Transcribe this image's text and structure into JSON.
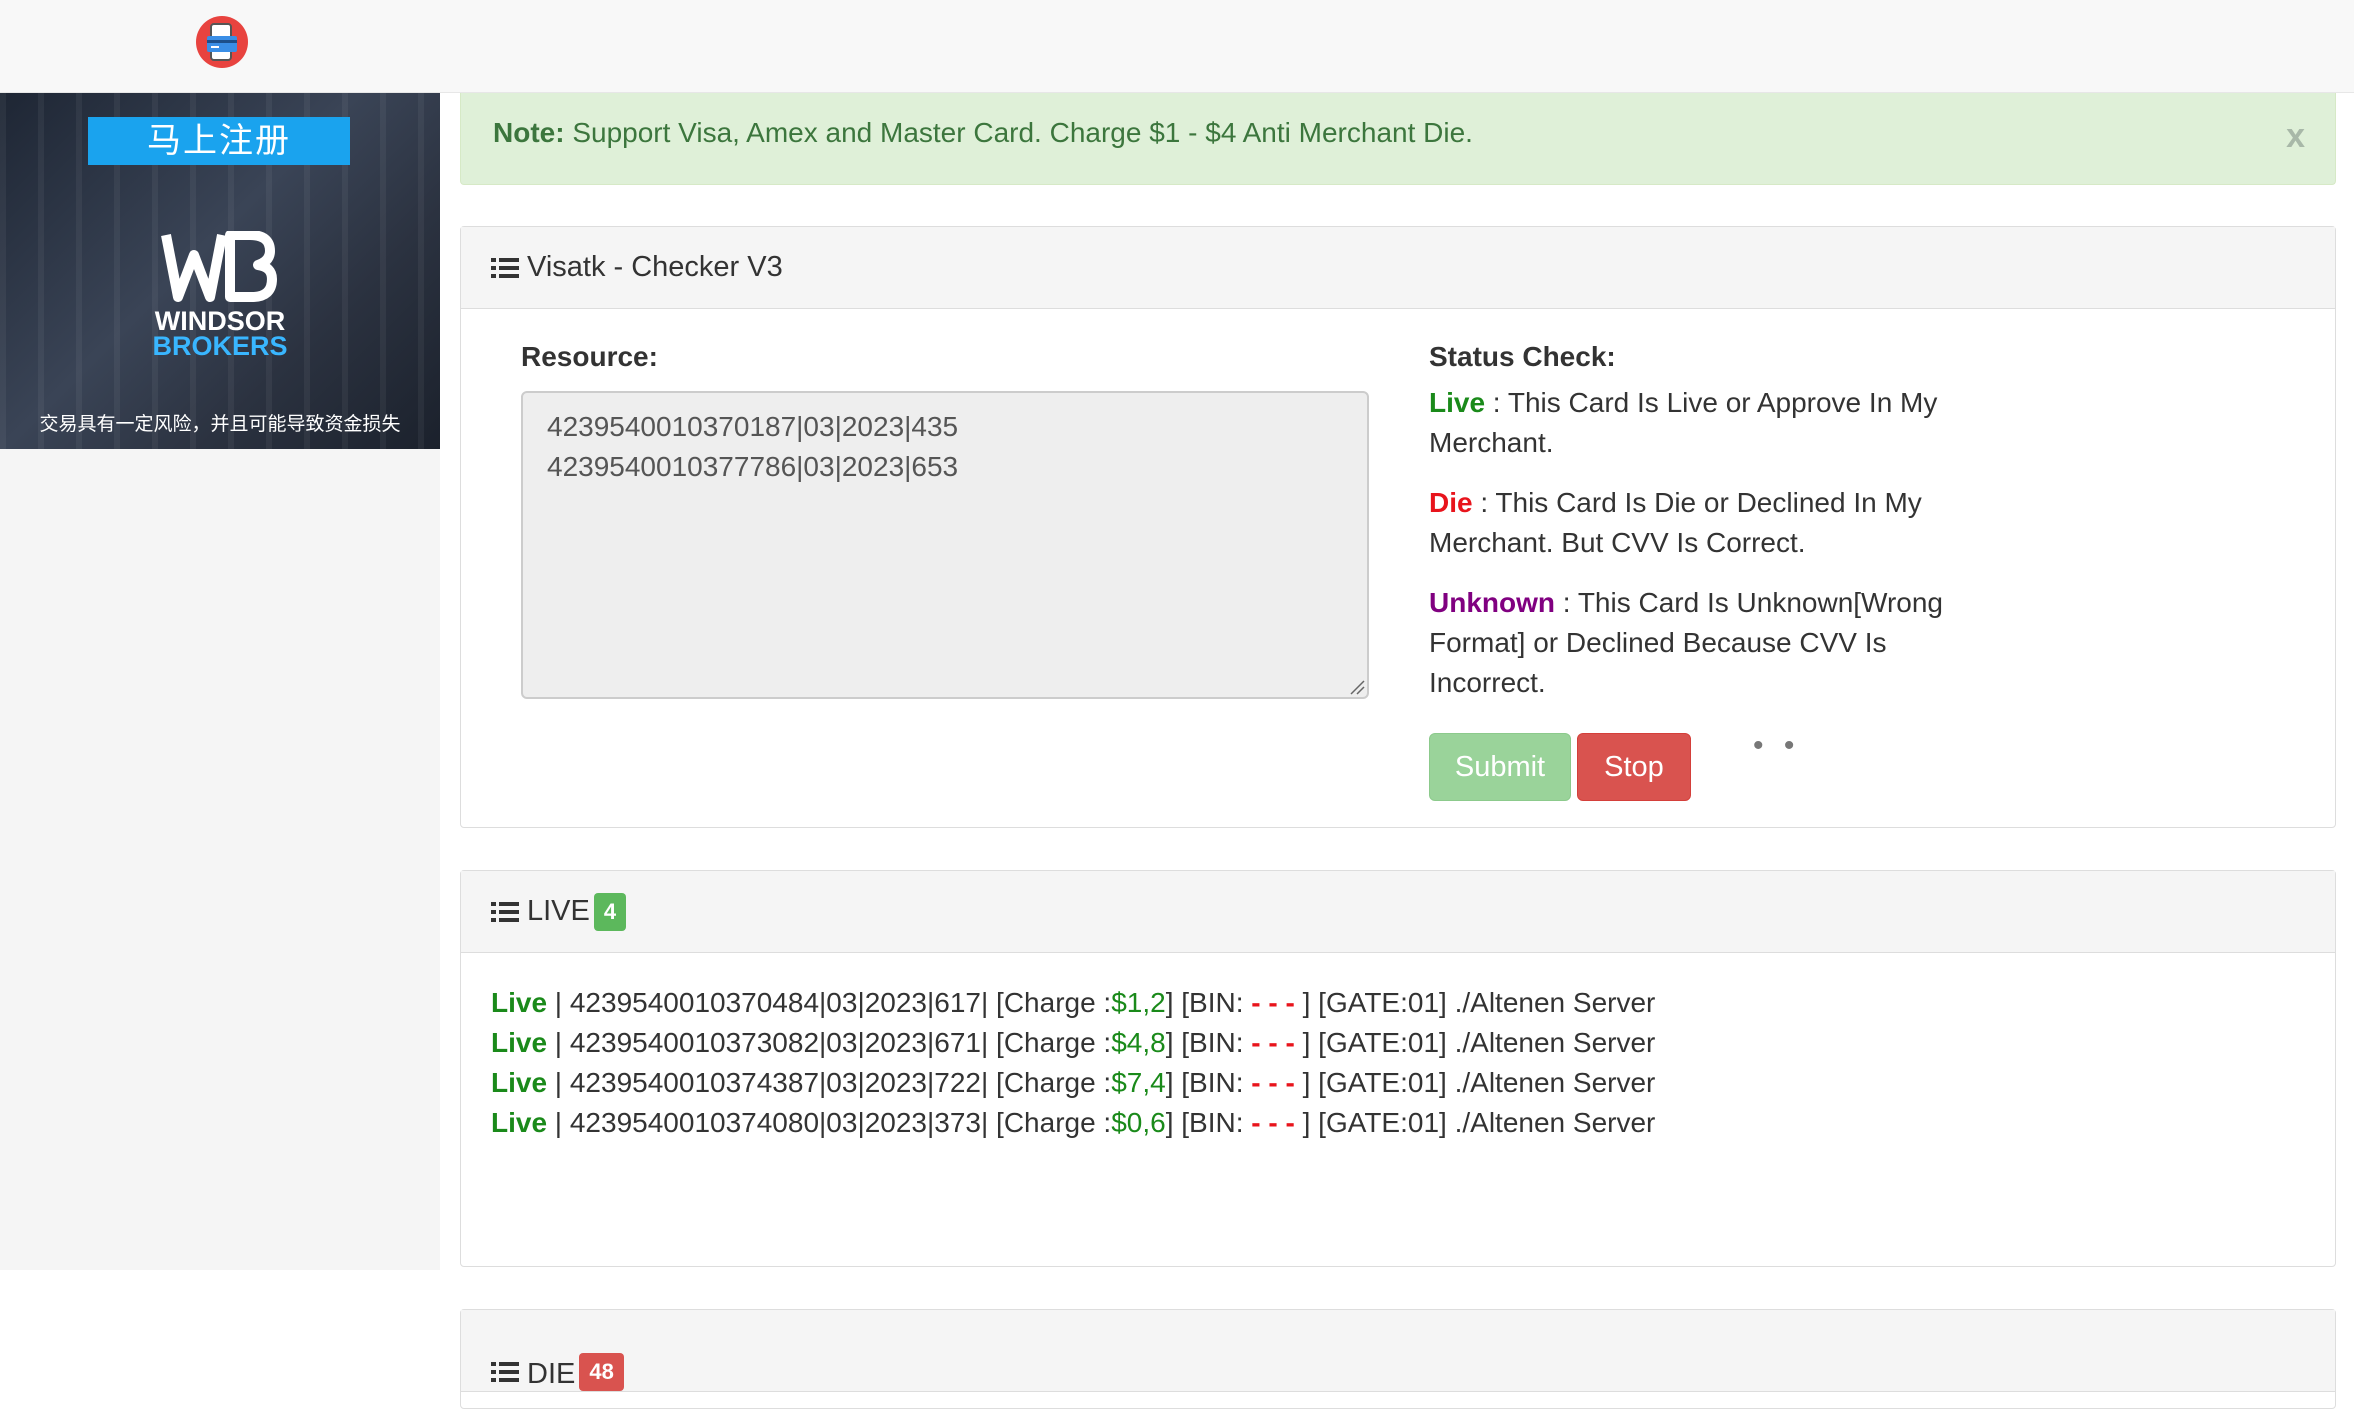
{
  "ad": {
    "register_label": "马上注册",
    "brand_line1": "WINDSOR",
    "brand_line2": "BROKERS",
    "disclaimer": "交易具有一定风险，并且可能导致资金损失"
  },
  "alert": {
    "label": "Note:",
    "message": "Support Visa, Amex and Master Card. Charge $1 - $4 Anti Merchant Die.",
    "close": "x"
  },
  "checker": {
    "title": "Visatk - Checker V3",
    "resource_label": "Resource:",
    "resource_value": "4239540010370187|03|2023|435\n4239540010377786|03|2023|653",
    "status_label": "Status Check:",
    "live_word": "Live",
    "live_desc": " : This Card Is Live or Approve In My Merchant.",
    "die_word": "Die",
    "die_desc": " : This Card Is Die or Declined In My Merchant. But CVV Is Correct.",
    "unknown_word": "Unknown",
    "unknown_desc": " : This Card Is Unknown[Wrong Format] or Declined Because CVV Is Incorrect.",
    "submit_label": "Submit",
    "stop_label": "Stop",
    "loading_dots": "• •"
  },
  "live_panel": {
    "title": "LIVE",
    "count": "4",
    "rows": [
      {
        "status": "Live",
        "card": " | 4239540010370484|03|2023|617| [Charge :",
        "charge": "$1,2",
        "bin_prefix": "] [BIN: ",
        "bin": "- - -",
        "suffix": " ] [GATE:01] ./Altenen Server"
      },
      {
        "status": "Live",
        "card": " | 4239540010373082|03|2023|671| [Charge :",
        "charge": "$4,8",
        "bin_prefix": "] [BIN: ",
        "bin": "- - -",
        "suffix": " ] [GATE:01] ./Altenen Server"
      },
      {
        "status": "Live",
        "card": " | 4239540010374387|03|2023|722| [Charge :",
        "charge": "$7,4",
        "bin_prefix": "] [BIN: ",
        "bin": "- - -",
        "suffix": " ] [GATE:01] ./Altenen Server"
      },
      {
        "status": "Live",
        "card": " | 4239540010374080|03|2023|373| [Charge :",
        "charge": "$0,6",
        "bin_prefix": "] [BIN: ",
        "bin": "- - -",
        "suffix": " ] [GATE:01] ./Altenen Server"
      }
    ]
  },
  "die_panel": {
    "title": "DIE",
    "count": "48"
  },
  "colors": {
    "live": "#1a8a1a",
    "die": "#e8141c",
    "unknown": "#800080",
    "badge_green": "#5cb85c",
    "badge_red": "#d9534f",
    "alert_bg": "#dff0d8"
  }
}
